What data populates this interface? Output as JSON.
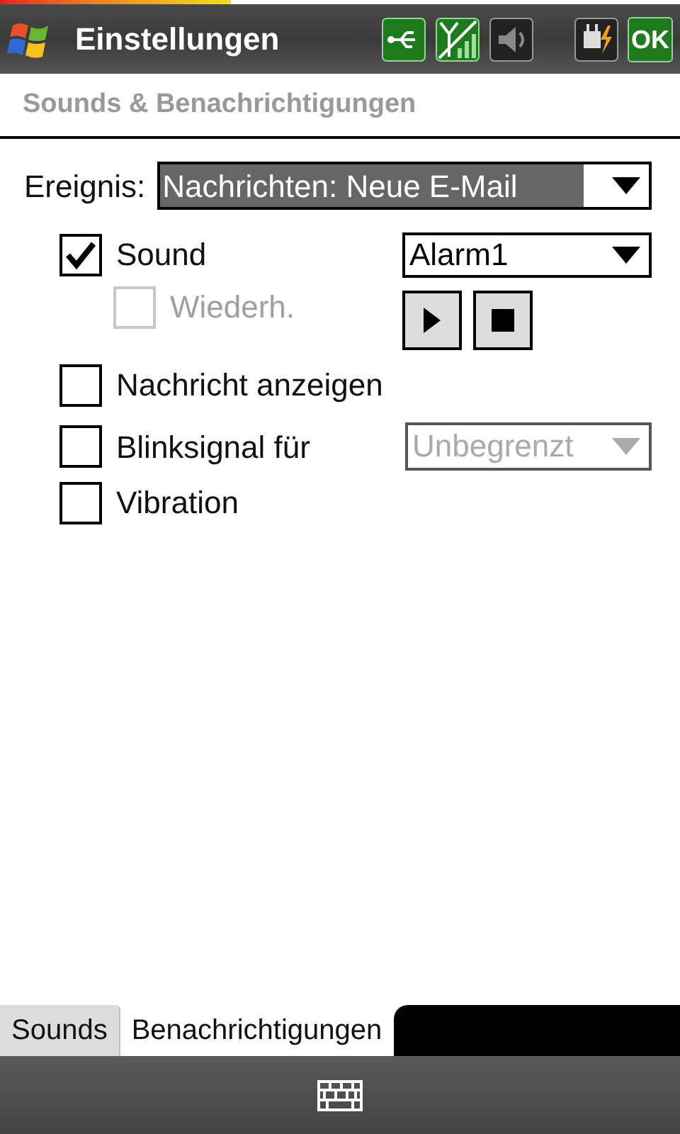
{
  "window": {
    "title": "Einstellungen",
    "ok_button": "OK"
  },
  "page_title": "Sounds & Benachrichtigungen",
  "event": {
    "label": "Ereignis:",
    "value": "Nachrichten: Neue E-Mail"
  },
  "sound": {
    "label": "Sound",
    "checked": true,
    "disabled": false
  },
  "sound_file": {
    "value": "Alarm1",
    "disabled": false
  },
  "repeat": {
    "label": "Wiederh.",
    "checked": false,
    "disabled": true
  },
  "show_message": {
    "label": "Nachricht anzeigen",
    "checked": false,
    "disabled": false
  },
  "blink": {
    "label": "Blinksignal für",
    "checked": false,
    "disabled": false
  },
  "blink_duration": {
    "value": "Unbegrenzt",
    "disabled": true
  },
  "vibration": {
    "label": "Vibration",
    "checked": false,
    "disabled": false
  },
  "tabs": [
    {
      "label": "Sounds",
      "selected": false
    },
    {
      "label": "Benachrichtigungen",
      "selected": true
    }
  ]
}
